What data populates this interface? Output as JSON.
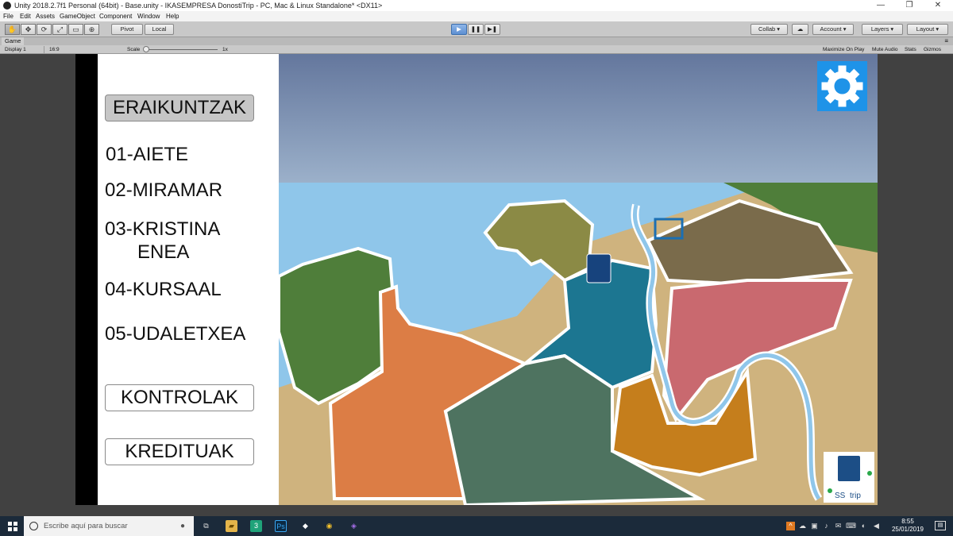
{
  "window": {
    "title": "Unity 2018.2.7f1 Personal (64bit) - Base.unity - IKASEMPRESA DonostiTrip - PC, Mac & Linux Standalone* <DX11>",
    "minimize": "—",
    "maximize": "❐",
    "close": "✕"
  },
  "menu": [
    "File",
    "Edit",
    "Assets",
    "GameObject",
    "Component",
    "Window",
    "Help"
  ],
  "toolbar": {
    "tools": [
      "✋",
      "✥",
      "⟳",
      "⤢",
      "▭",
      "⊕"
    ],
    "pivot": "Pivot",
    "local": "Local",
    "play": "▶",
    "pause": "❚❚",
    "step": "▶❚",
    "collab": "Collab ▾",
    "cloud": "☁",
    "account": "Account",
    "layers": "Layers",
    "layout": "Layout",
    "dropdown_arrow": "▾"
  },
  "game_tab": {
    "label": "Game",
    "more": "≡",
    "display": "Display 1",
    "aspect": "16:9",
    "scale_label": "Scale",
    "scale_value": "1x",
    "maximize_on_play": "Maximize On Play",
    "mute_audio": "Mute Audio",
    "stats": "Stats",
    "gizmos": "Gizmos"
  },
  "game_menu": {
    "eraikuntzak": "ERAIKUNTZAK",
    "items": [
      "01-AIETE",
      "02-MIRAMAR",
      "03-KRISTINA",
      "ENEA",
      "04-KURSAAL",
      "05-UDALETXEA"
    ],
    "kontrolak": "KONTROLAK",
    "kredituak": "KREDITUAK"
  },
  "logo": {
    "left": "SS",
    "right": "trip"
  },
  "colors": {
    "sea": "#8fc6ea",
    "sky_top": "#64779d",
    "sky_bottom": "#9eb3cc",
    "settings_bg": "#1e93e8",
    "green_district": "#4f7e3a",
    "olive_district": "#8b8a45",
    "orange_district": "#dc7d45",
    "teal_district": "#1c7691",
    "pink_district": "#c9696f",
    "darkgreen_district": "#4e7360",
    "brown_district": "#7a6b4b",
    "amber_district": "#c57e1c",
    "sand": "#cfb37e"
  },
  "taskbar": {
    "search_placeholder": "Escribe aquí para buscar",
    "time": "8:55",
    "date": "25/01/2019",
    "apps": [
      "⧉",
      "▰",
      "3",
      "Ps",
      "◆",
      "◉",
      "◈"
    ],
    "tray": [
      "^",
      "☁",
      "▣",
      "♪",
      "✉",
      "⌨",
      "◐",
      "◀"
    ],
    "notifications": "▤"
  }
}
